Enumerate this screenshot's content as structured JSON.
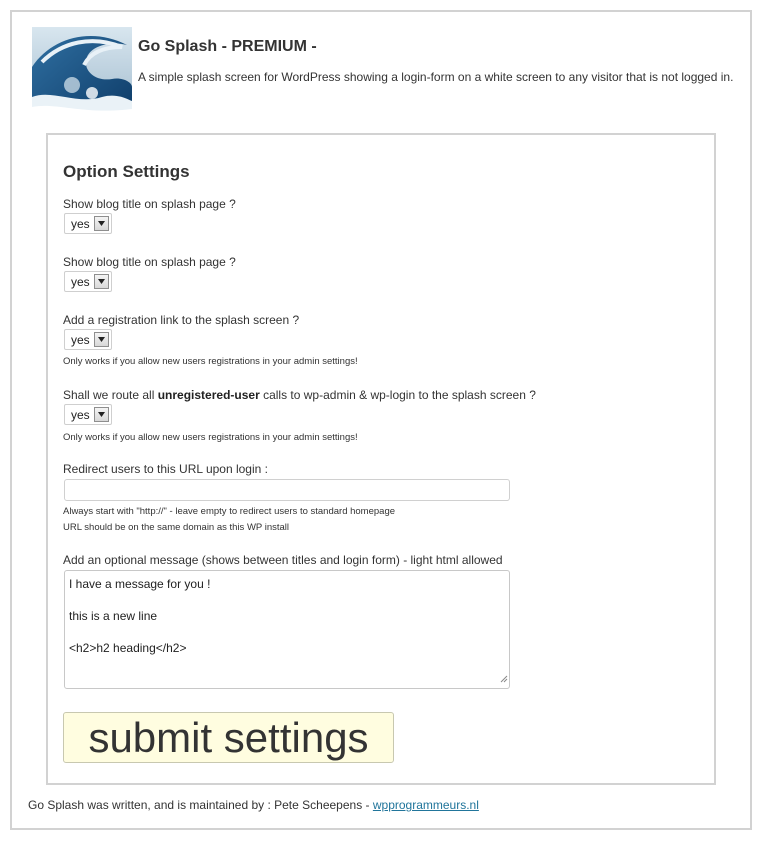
{
  "header": {
    "title": "Go Splash - PREMIUM -",
    "description": "A simple splash screen for WordPress showing a login-form on a white screen to any visitor that is not logged in.",
    "logo_icon": "wave-logo-icon"
  },
  "settings": {
    "title": "Option Settings",
    "fields": [
      {
        "label": "Show blog title on splash page ?",
        "value": "yes"
      },
      {
        "label": "Show blog title on splash page ?",
        "value": "yes"
      },
      {
        "label": "Add a registration link to the splash screen ?",
        "value": "yes",
        "hint": "Only works if you allow new users registrations in your admin settings!"
      },
      {
        "label_before": "Shall we route all ",
        "label_bold": "unregistered-user",
        "label_after": " calls to wp-admin & wp-login to the splash screen ?",
        "value": "yes",
        "hint": "Only works if you allow new users registrations in your admin settings!"
      }
    ],
    "redirect": {
      "label": "Redirect users to this URL upon login :",
      "value": "",
      "hint1": "Always start with \"http://\" - leave empty to redirect users to standard homepage",
      "hint2": "URL should be on the same domain as this WP install"
    },
    "message": {
      "label": "Add an optional message (shows between titles and login form) - light html allowed",
      "lines": [
        "I have a message for you !",
        "",
        "this is a new line",
        "",
        "<h2>h2 heading</h2>"
      ]
    },
    "submit_label": "submit settings"
  },
  "footer": {
    "text": "Go Splash was written, and is maintained by : Pete Scheepens - ",
    "link": "wpprogrammeurs.nl"
  }
}
